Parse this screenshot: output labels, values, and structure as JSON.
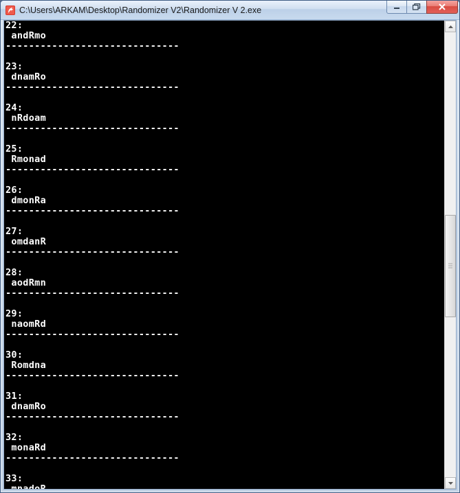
{
  "window": {
    "title": "C:\\Users\\ARKAM\\Desktop\\Randomizer V2\\Randomizer V 2.exe"
  },
  "scrollbar": {
    "thumb_top_pct": 41,
    "thumb_height_pct": 23
  },
  "separator": "------------------------------",
  "entries": [
    {
      "n": "22",
      "v": "andRmo"
    },
    {
      "n": "23",
      "v": "dnamRo"
    },
    {
      "n": "24",
      "v": "nRdoam"
    },
    {
      "n": "25",
      "v": "Rmonad"
    },
    {
      "n": "26",
      "v": "dmonRa"
    },
    {
      "n": "27",
      "v": "omdanR"
    },
    {
      "n": "28",
      "v": "aodRmn"
    },
    {
      "n": "29",
      "v": "naomRd"
    },
    {
      "n": "30",
      "v": "Romdna"
    },
    {
      "n": "31",
      "v": "dnamRo"
    },
    {
      "n": "32",
      "v": "monaRd"
    },
    {
      "n": "33",
      "v": "mnadoR"
    }
  ]
}
